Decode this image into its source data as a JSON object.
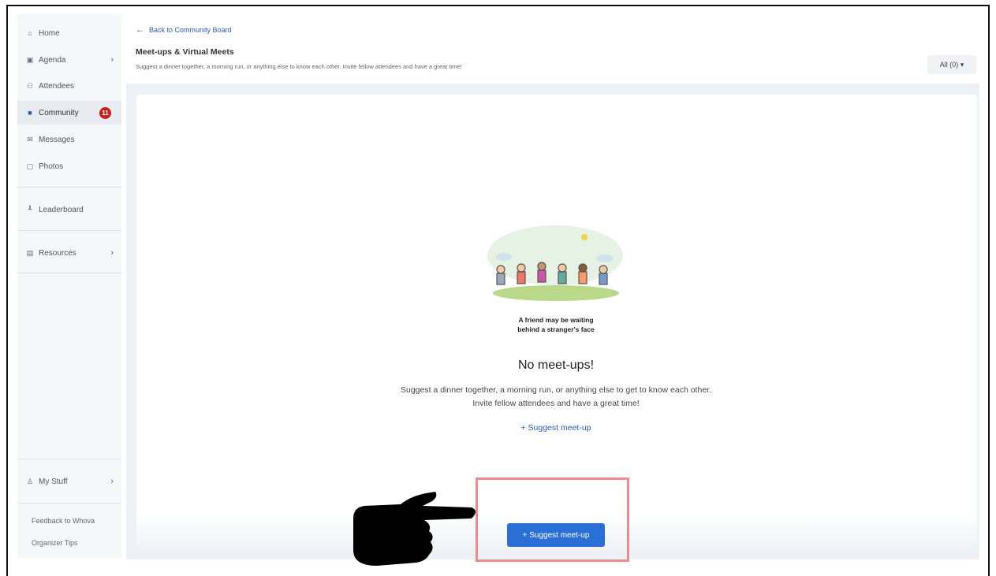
{
  "sidebar": {
    "items": [
      {
        "icon": "home-icon",
        "glyph": "⌂",
        "label": "Home"
      },
      {
        "icon": "calendar-icon",
        "glyph": "▣",
        "label": "Agenda",
        "chevron": "›"
      },
      {
        "icon": "people-icon",
        "glyph": "⚇",
        "label": "Attendees"
      },
      {
        "icon": "chat-icon",
        "glyph": "■",
        "label": "Community",
        "badge": "11"
      },
      {
        "icon": "mail-icon",
        "glyph": "✉",
        "label": "Messages"
      },
      {
        "icon": "photo-icon",
        "glyph": "▢",
        "label": "Photos"
      },
      {
        "icon": "leaderboard-icon",
        "glyph": "┸",
        "label": "Leaderboard"
      },
      {
        "icon": "folder-icon",
        "glyph": "▤",
        "label": "Resources",
        "chevron": "›"
      },
      {
        "icon": "user-icon",
        "glyph": "♙",
        "label": "My Stuff",
        "chevron": "›"
      }
    ],
    "footer": [
      "Feedback to Whova",
      "Organizer Tips"
    ]
  },
  "header": {
    "back_label": "Back to Community Board",
    "title": "Meet-ups & Virtual Meets",
    "subtitle": "Suggest a dinner together, a morning run, or anything else to know each other. Invite fellow attendees and have a great time!",
    "filter_label": "All (0) ▾"
  },
  "empty_state": {
    "tagline": "A friend may be waiting\nbehind a stranger's face",
    "title": "No meet-ups!",
    "description_line1": "Suggest a dinner together, a morning run, or anything else to get to know each other.",
    "description_line2": "Invite fellow attendees and have a great time!",
    "link_label": "+ Suggest meet-up"
  },
  "primary_button": "+ Suggest meet-up",
  "colors": {
    "accent": "#2a6fd6",
    "badge": "#c81e1e",
    "highlight": "#ef8a8e"
  }
}
